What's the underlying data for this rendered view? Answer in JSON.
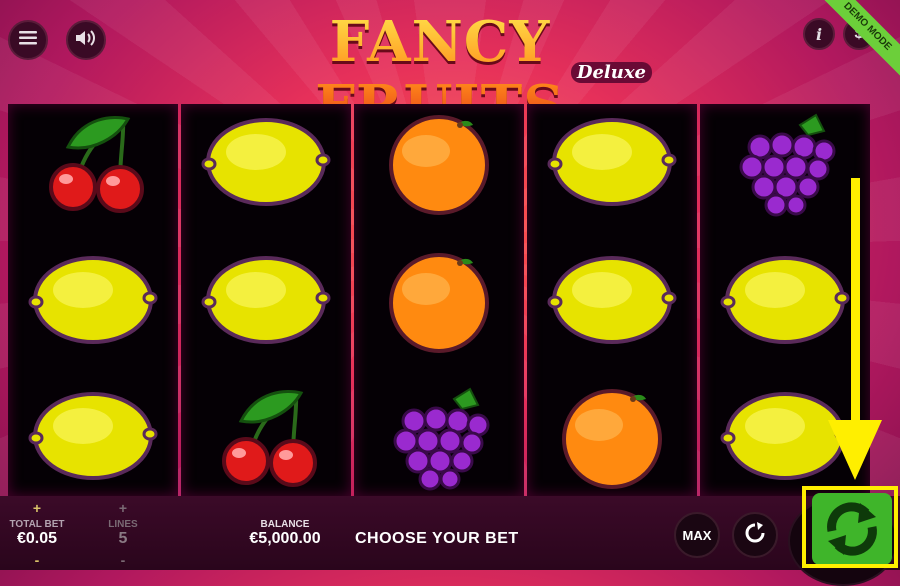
{
  "game": {
    "title": "FANCY FRUITS",
    "subtitle": "Deluxe",
    "demo_ribbon": "DEMO MODE"
  },
  "top_buttons": {
    "info": "i",
    "paytable": "$"
  },
  "reels": [
    [
      "cherries",
      "lemon",
      "lemon"
    ],
    [
      "lemon",
      "lemon",
      "cherries"
    ],
    [
      "orange",
      "orange",
      "grapes"
    ],
    [
      "lemon",
      "lemon",
      "orange"
    ],
    [
      "grapes",
      "lemon",
      "lemon"
    ]
  ],
  "bottom": {
    "total_bet_label": "TOTAL BET",
    "total_bet_value": "€0.05",
    "lines_label": "LINES",
    "lines_value": "5",
    "balance_label": "BALANCE",
    "balance_value": "€5,000.00",
    "message": "CHOOSE YOUR BET",
    "max_label": "MAX",
    "plus": "+",
    "minus": "-"
  },
  "colors": {
    "accent_highlight": "#ffef00",
    "spin_green": "#4fc23a"
  }
}
